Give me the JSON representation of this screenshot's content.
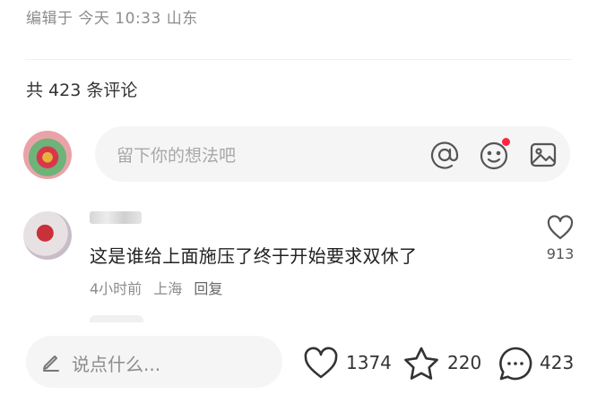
{
  "post": {
    "edited_info": "编辑于 今天 10:33 山东",
    "comment_count_label": "共 423 条评论"
  },
  "comment_input": {
    "placeholder": "留下你的想法吧",
    "icons": [
      "at-icon",
      "emoji-icon",
      "image-icon"
    ],
    "emoji_has_notification": true
  },
  "comments": [
    {
      "text": "这是谁给上面施压了终于开始要求双休了",
      "time": "4小时前",
      "location": "上海",
      "reply_label": "回复",
      "likes": "913"
    }
  ],
  "bottom_bar": {
    "input_placeholder": "说点什么...",
    "likes": "1374",
    "favorites": "220",
    "comments": "423"
  },
  "colors": {
    "notification_dot": "#ff2442",
    "muted_text": "#8c8c8c",
    "input_bg": "#f5f5f5"
  }
}
